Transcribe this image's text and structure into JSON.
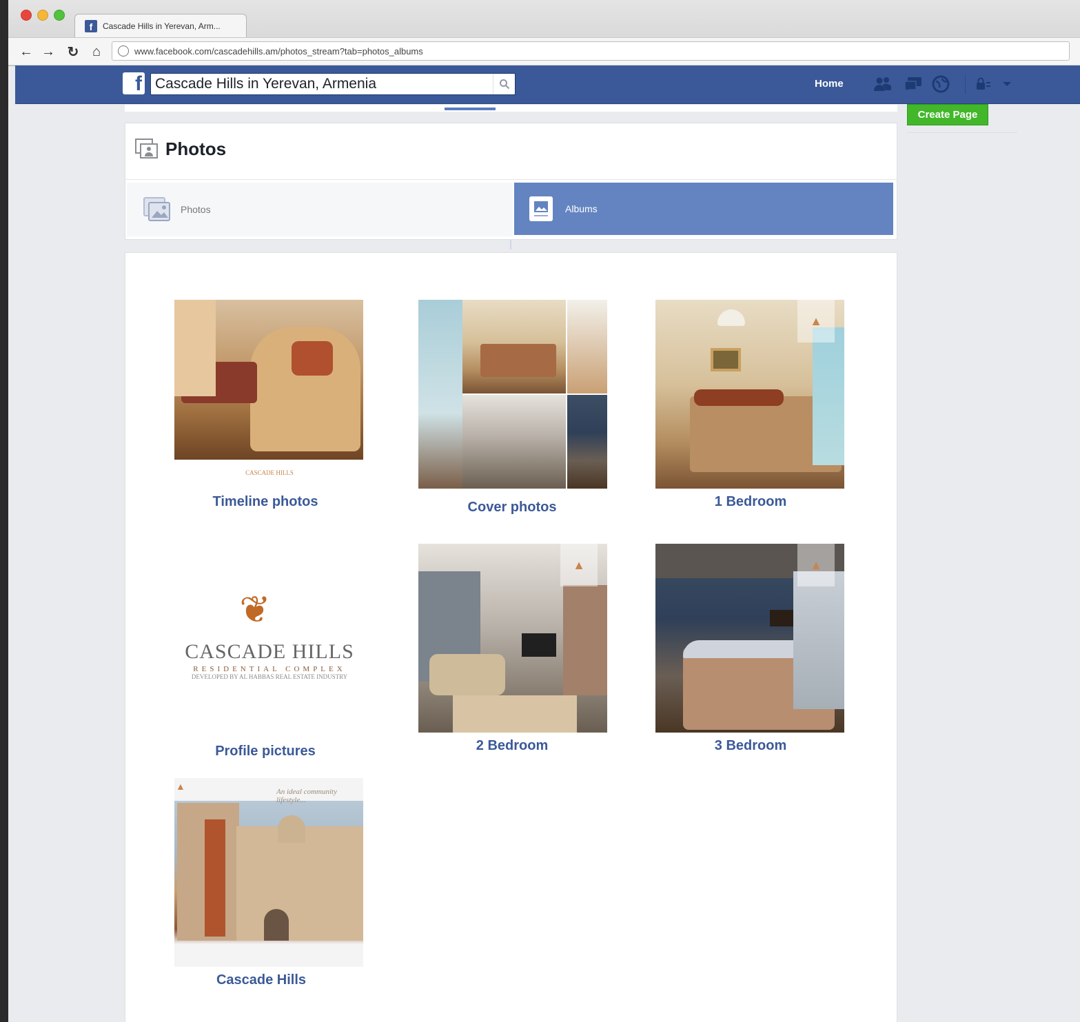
{
  "browser": {
    "tab_title": "Cascade Hills in Yerevan, Arm...",
    "url": "www.facebook.com/cascadehills.am/photos_stream?tab=photos_albums"
  },
  "fb_nav": {
    "search_value": "Cascade Hills in Yerevan, Armenia",
    "home_label": "Home"
  },
  "sidebar": {
    "create_page_label": "Create Page"
  },
  "photos": {
    "title": "Photos",
    "segments": [
      {
        "label": "Photos"
      },
      {
        "label": "Albums"
      }
    ]
  },
  "albums": [
    {
      "label": "Timeline photos",
      "logo_text": "CASCADE HILLS"
    },
    {
      "label": "Cover photos"
    },
    {
      "label": "1 Bedroom"
    },
    {
      "label": "Profile pictures",
      "logo_main": "CASCADE HILLS",
      "logo_sub": "RESIDENTIAL COMPLEX",
      "logo_small": "DEVELOPED BY AL HABBAS REAL ESTATE INDUSTRY"
    },
    {
      "label": "2 Bedroom"
    },
    {
      "label": "3 Bedroom"
    },
    {
      "label": "Cascade Hills",
      "tagline": "An ideal community lifestyle..."
    }
  ],
  "colors": {
    "fb_blue": "#3b5998",
    "album_link": "#3b5998",
    "create_page_green": "#42b72a",
    "segment_active": "#6484c1"
  },
  "icons": [
    "facebook-logo-icon",
    "search-icon",
    "friends-icon",
    "messages-icon",
    "notifications-globe-icon",
    "privacy-lock-icon",
    "account-caret-icon",
    "photos-icon",
    "albums-icon"
  ]
}
